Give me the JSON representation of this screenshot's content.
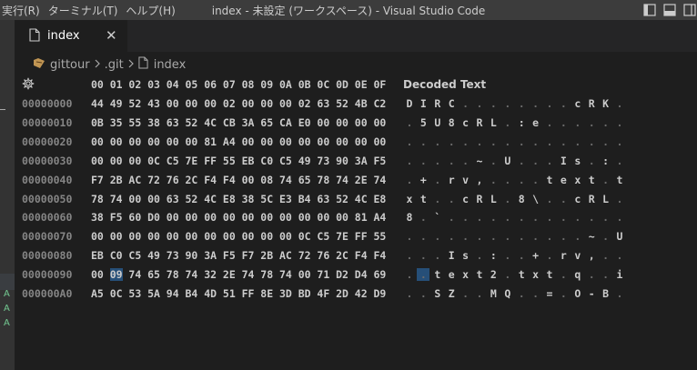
{
  "titlebar": {
    "menu": [
      "実行(R)",
      "ターミナル(T)",
      "ヘルプ(H)"
    ],
    "title": "index - 未設定 (ワークスペース) - Visual Studio Code"
  },
  "tab": {
    "label": "index",
    "close": "✕"
  },
  "breadcrumb": {
    "items": [
      "gittour",
      ".git",
      "index"
    ]
  },
  "hex": {
    "columns": [
      "00",
      "01",
      "02",
      "03",
      "04",
      "05",
      "06",
      "07",
      "08",
      "09",
      "0A",
      "0B",
      "0C",
      "0D",
      "0E",
      "0F"
    ],
    "decoded_title": "Decoded Text",
    "selected": {
      "row": 9,
      "col": 1
    },
    "rows": [
      {
        "address": "00000000",
        "bytes": [
          "44",
          "49",
          "52",
          "43",
          "00",
          "00",
          "00",
          "02",
          "00",
          "00",
          "00",
          "02",
          "63",
          "52",
          "4B",
          "C2"
        ],
        "decoded": [
          "D",
          "I",
          "R",
          "C",
          ".",
          ".",
          ".",
          ".",
          ".",
          ".",
          ".",
          ".",
          "c",
          "R",
          "K",
          "."
        ]
      },
      {
        "address": "00000010",
        "bytes": [
          "0B",
          "35",
          "55",
          "38",
          "63",
          "52",
          "4C",
          "CB",
          "3A",
          "65",
          "CA",
          "E0",
          "00",
          "00",
          "00",
          "00"
        ],
        "decoded": [
          ".",
          "5",
          "U",
          "8",
          "c",
          "R",
          "L",
          ".",
          ":",
          "e",
          ".",
          ".",
          ".",
          ".",
          ".",
          "."
        ]
      },
      {
        "address": "00000020",
        "bytes": [
          "00",
          "00",
          "00",
          "00",
          "00",
          "00",
          "81",
          "A4",
          "00",
          "00",
          "00",
          "00",
          "00",
          "00",
          "00",
          "00"
        ],
        "decoded": [
          ".",
          ".",
          ".",
          ".",
          ".",
          ".",
          ".",
          ".",
          ".",
          ".",
          ".",
          ".",
          ".",
          ".",
          ".",
          "."
        ]
      },
      {
        "address": "00000030",
        "bytes": [
          "00",
          "00",
          "00",
          "0C",
          "C5",
          "7E",
          "FF",
          "55",
          "EB",
          "C0",
          "C5",
          "49",
          "73",
          "90",
          "3A",
          "F5"
        ],
        "decoded": [
          ".",
          ".",
          ".",
          ".",
          ".",
          "~",
          ".",
          "U",
          ".",
          ".",
          ".",
          "I",
          "s",
          ".",
          ":",
          "."
        ]
      },
      {
        "address": "00000040",
        "bytes": [
          "F7",
          "2B",
          "AC",
          "72",
          "76",
          "2C",
          "F4",
          "F4",
          "00",
          "08",
          "74",
          "65",
          "78",
          "74",
          "2E",
          "74"
        ],
        "decoded": [
          ".",
          "+",
          ".",
          "r",
          "v",
          ",",
          ".",
          ".",
          ".",
          ".",
          "t",
          "e",
          "x",
          "t",
          ".",
          "t"
        ]
      },
      {
        "address": "00000050",
        "bytes": [
          "78",
          "74",
          "00",
          "00",
          "63",
          "52",
          "4C",
          "E8",
          "38",
          "5C",
          "E3",
          "B4",
          "63",
          "52",
          "4C",
          "E8"
        ],
        "decoded": [
          "x",
          "t",
          ".",
          ".",
          "c",
          "R",
          "L",
          ".",
          "8",
          "\\",
          ".",
          ".",
          "c",
          "R",
          "L",
          "."
        ]
      },
      {
        "address": "00000060",
        "bytes": [
          "38",
          "F5",
          "60",
          "D0",
          "00",
          "00",
          "00",
          "00",
          "00",
          "00",
          "00",
          "00",
          "00",
          "00",
          "81",
          "A4"
        ],
        "decoded": [
          "8",
          ".",
          "`",
          ".",
          ".",
          ".",
          ".",
          ".",
          ".",
          ".",
          ".",
          ".",
          ".",
          ".",
          ".",
          "."
        ]
      },
      {
        "address": "00000070",
        "bytes": [
          "00",
          "00",
          "00",
          "00",
          "00",
          "00",
          "00",
          "00",
          "00",
          "00",
          "00",
          "0C",
          "C5",
          "7E",
          "FF",
          "55"
        ],
        "decoded": [
          ".",
          ".",
          ".",
          ".",
          ".",
          ".",
          ".",
          ".",
          ".",
          ".",
          ".",
          ".",
          ".",
          "~",
          ".",
          "U"
        ]
      },
      {
        "address": "00000080",
        "bytes": [
          "EB",
          "C0",
          "C5",
          "49",
          "73",
          "90",
          "3A",
          "F5",
          "F7",
          "2B",
          "AC",
          "72",
          "76",
          "2C",
          "F4",
          "F4"
        ],
        "decoded": [
          ".",
          ".",
          ".",
          "I",
          "s",
          ".",
          ":",
          ".",
          ".",
          "+",
          ".",
          "r",
          "v",
          ",",
          ".",
          "."
        ]
      },
      {
        "address": "00000090",
        "bytes": [
          "00",
          "09",
          "74",
          "65",
          "78",
          "74",
          "32",
          "2E",
          "74",
          "78",
          "74",
          "00",
          "71",
          "D2",
          "D4",
          "69"
        ],
        "decoded": [
          ".",
          ".",
          "t",
          "e",
          "x",
          "t",
          "2",
          ".",
          "t",
          "x",
          "t",
          ".",
          "q",
          ".",
          ".",
          "i"
        ]
      },
      {
        "address": "000000A0",
        "bytes": [
          "A5",
          "0C",
          "53",
          "5A",
          "94",
          "B4",
          "4D",
          "51",
          "FF",
          "8E",
          "3D",
          "BD",
          "4F",
          "2D",
          "42",
          "D9"
        ],
        "decoded": [
          ".",
          ".",
          "S",
          "Z",
          ".",
          ".",
          "M",
          "Q",
          ".",
          ".",
          "=",
          ".",
          "O",
          "-",
          "B",
          "."
        ]
      }
    ]
  },
  "activity_marks": [
    "A",
    "A",
    "A"
  ],
  "colors": {
    "titlebar_bg": "#3c3c3c",
    "editor_bg": "#1e1e1e",
    "selection": "#264f78",
    "address": "#858585"
  },
  "icons": [
    "layout-sidebar-icon",
    "layout-panel-icon",
    "layout-split-icon",
    "file-icon",
    "close-icon",
    "folder-icon",
    "chevron-right-icon",
    "gear-icon"
  ]
}
